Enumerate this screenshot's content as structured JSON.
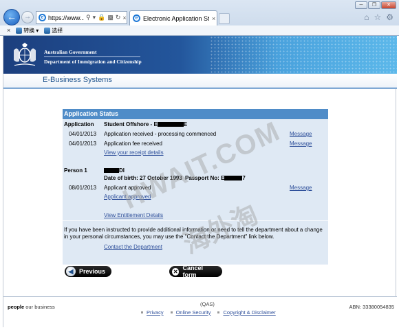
{
  "browser": {
    "url": "https://www....",
    "tab_title": "Electronic Application St...",
    "cmd_convert": "转换",
    "cmd_select": "选择",
    "window_min": "─",
    "window_restore": "❐",
    "window_close": "✕"
  },
  "banner": {
    "gov_name": "Australian Government",
    "dept_name": "Department of Immigration and Citizenship",
    "system_name": "E-Business Systems"
  },
  "status": {
    "heading": "Application Status",
    "application_label": "Application",
    "application_type": "Student Offshore - E",
    "application_suffix": "E",
    "events": [
      {
        "date": "04/01/2013",
        "text": "Application received - processing commenced",
        "action": "Message"
      },
      {
        "date": "04/01/2013",
        "text": "Application fee received",
        "action": "Message"
      }
    ],
    "receipt_link": "View your receipt details",
    "person_label": "Person 1",
    "person_name_suffix": "DI",
    "dob_label": "Date of birth: 27 October 1993",
    "passport_label": "Passport No: E",
    "passport_suffix": "7",
    "person_event": {
      "date": "08/01/2013",
      "text": "Applicant approved",
      "action": "Message"
    },
    "approved_link": "Applicant approved",
    "entitlement_link": "View Entitlement Details",
    "instructions": "If you have been instructed to provide additional information or need to tell the department about a change in your personal circumstances, you may use the \"Contact the Department\" link below.",
    "contact_link": "Contact the Department"
  },
  "buttons": {
    "previous": "Previous",
    "cancel": "Cancel form"
  },
  "footer": {
    "people": "people",
    "business": "our business",
    "qas": "(QAS)",
    "links": [
      "Privacy",
      "Online Security",
      "Copyright & Disclaimer"
    ],
    "abn": "ABN: 33380054835"
  },
  "watermark": {
    "line1": "HWAIT.COM",
    "line2": "海外淘"
  }
}
